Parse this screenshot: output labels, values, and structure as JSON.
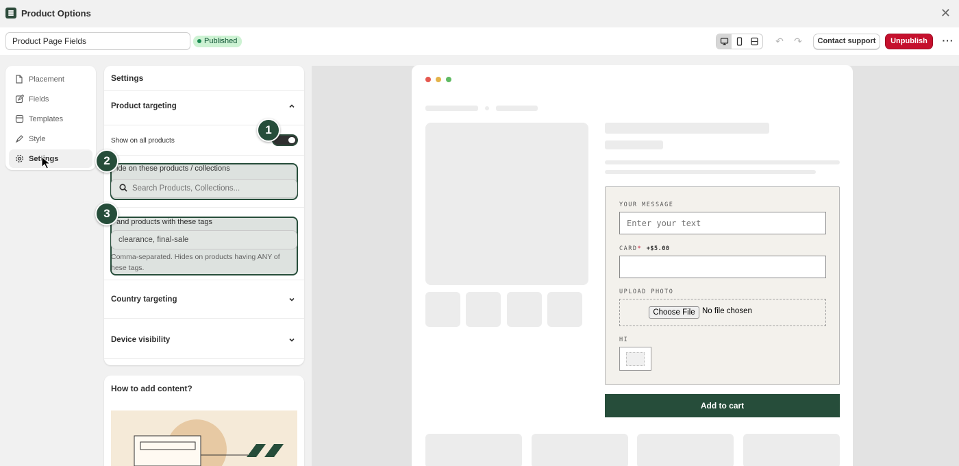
{
  "window": {
    "title": "Product Options"
  },
  "toolbar": {
    "name_value": "Product Page Fields",
    "status_badge": "Published",
    "contact_support": "Contact support",
    "unpublish": "Unpublish",
    "more": "···"
  },
  "sidebar": {
    "items": [
      {
        "label": "Placement",
        "icon": "page-icon"
      },
      {
        "label": "Fields",
        "icon": "edit-icon"
      },
      {
        "label": "Templates",
        "icon": "templates-icon"
      },
      {
        "label": "Style",
        "icon": "brush-icon"
      },
      {
        "label": "Settings",
        "icon": "gear-icon",
        "active": true
      }
    ]
  },
  "settings": {
    "title": "Settings",
    "product_targeting": {
      "title": "Product targeting",
      "show_all_label": "Show on all products",
      "show_all_enabled": true,
      "hide_label": "Hide on these products / collections",
      "hide_label_visible": "ide on these products / collections",
      "search_placeholder": "Search Products, Collections...",
      "tags_label": "and products with these tags",
      "tags_value": "clearance, final-sale",
      "tags_help": "Comma-separated. Hides on products having ANY of these tags.",
      "tags_help_line1": "Comma-separated. Hides on products having ANY of",
      "tags_help_line2": "hese tags."
    },
    "country_targeting": {
      "title": "Country targeting"
    },
    "device_visibility": {
      "title": "Device visibility"
    }
  },
  "markers": [
    "1",
    "2",
    "3"
  ],
  "howto": {
    "title": "How to add content?"
  },
  "preview": {
    "form": {
      "message_label": "YOUR MESSAGE",
      "message_placeholder": "Enter your text",
      "card_label": "CARD",
      "card_required": "*",
      "card_price": "+$5.00",
      "upload_label": "UPLOAD PHOTO",
      "choose_file": "Choose File",
      "no_file": "No file chosen",
      "hi_label": "HI"
    },
    "add_to_cart": "Add to cart"
  },
  "colors": {
    "brand_green": "#264d3a",
    "unpublish_red": "#c5102d",
    "published_badge_bg": "#cdf2d3",
    "highlight": "#264d3a"
  }
}
